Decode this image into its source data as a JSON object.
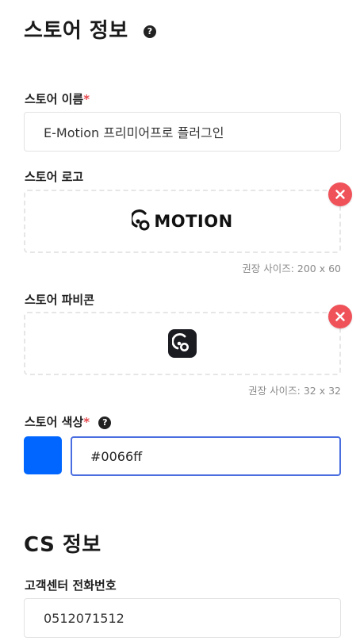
{
  "store_info": {
    "title": "스토어 정보",
    "help_glyph": "?",
    "name_field": {
      "label": "스토어 이름",
      "required_mark": "*",
      "value": "E-Motion 프리미어프로 플러그인"
    },
    "logo_field": {
      "label": "스토어 로고",
      "logo_text": "MOTION",
      "hint": "권장 사이즈: 200 x 60"
    },
    "favicon_field": {
      "label": "스토어 파비콘",
      "hint": "권장 사이즈: 32 x 32"
    },
    "color_field": {
      "label": "스토어 색상",
      "required_mark": "*",
      "help_glyph": "?",
      "value": "#0066ff",
      "swatch_color": "#0066ff"
    }
  },
  "cs_info": {
    "title": "CS 정보",
    "phone_field": {
      "label": "고객센터 전화번호",
      "value": "0512071512"
    }
  },
  "colors": {
    "remove_button": "#f0525a",
    "focus_border": "#4a6ee0",
    "required": "#e5484d"
  },
  "icons": {
    "remove": "close-icon",
    "help": "help-icon",
    "logo": "emotion-logo-icon",
    "favicon": "emotion-favicon-icon"
  }
}
